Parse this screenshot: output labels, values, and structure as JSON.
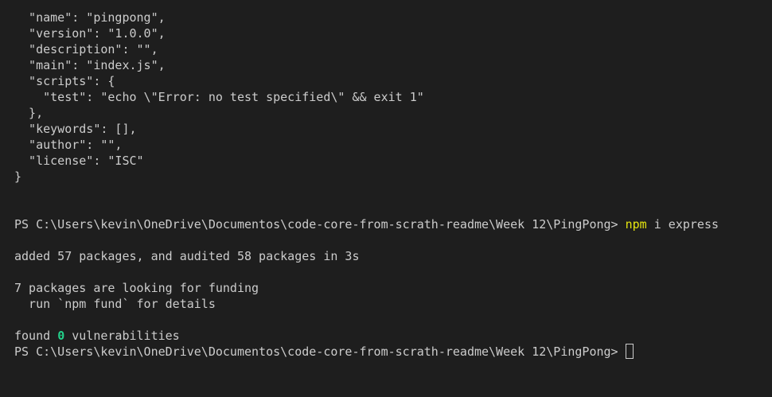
{
  "terminal": {
    "package_json_lines": [
      "  \"name\": \"pingpong\",",
      "  \"version\": \"1.0.0\",",
      "  \"description\": \"\",",
      "  \"main\": \"index.js\",",
      "  \"scripts\": {",
      "    \"test\": \"echo \\\"Error: no test specified\\\" && exit 1\"",
      "  },",
      "  \"keywords\": [],",
      "  \"author\": \"\",",
      "  \"license\": \"ISC\"",
      "}"
    ],
    "prompt": "PS C:\\Users\\kevin\\OneDrive\\Documentos\\code-core-from-scrath-readme\\Week 12\\PingPong>",
    "command_name": "npm",
    "command_args": " i express",
    "added_line": "added 57 packages, and audited 58 packages in 3s",
    "funding_line": "7 packages are looking for funding",
    "fund_hint_line": "  run `npm fund` for details",
    "found_prefix": "found ",
    "vuln_count": "0",
    "found_suffix": " vulnerabilities",
    "colors": {
      "background": "#1e1e1e",
      "text": "#cccccc",
      "command": "#e5e510",
      "zero_vulnerabilities": "#23d18b"
    }
  }
}
